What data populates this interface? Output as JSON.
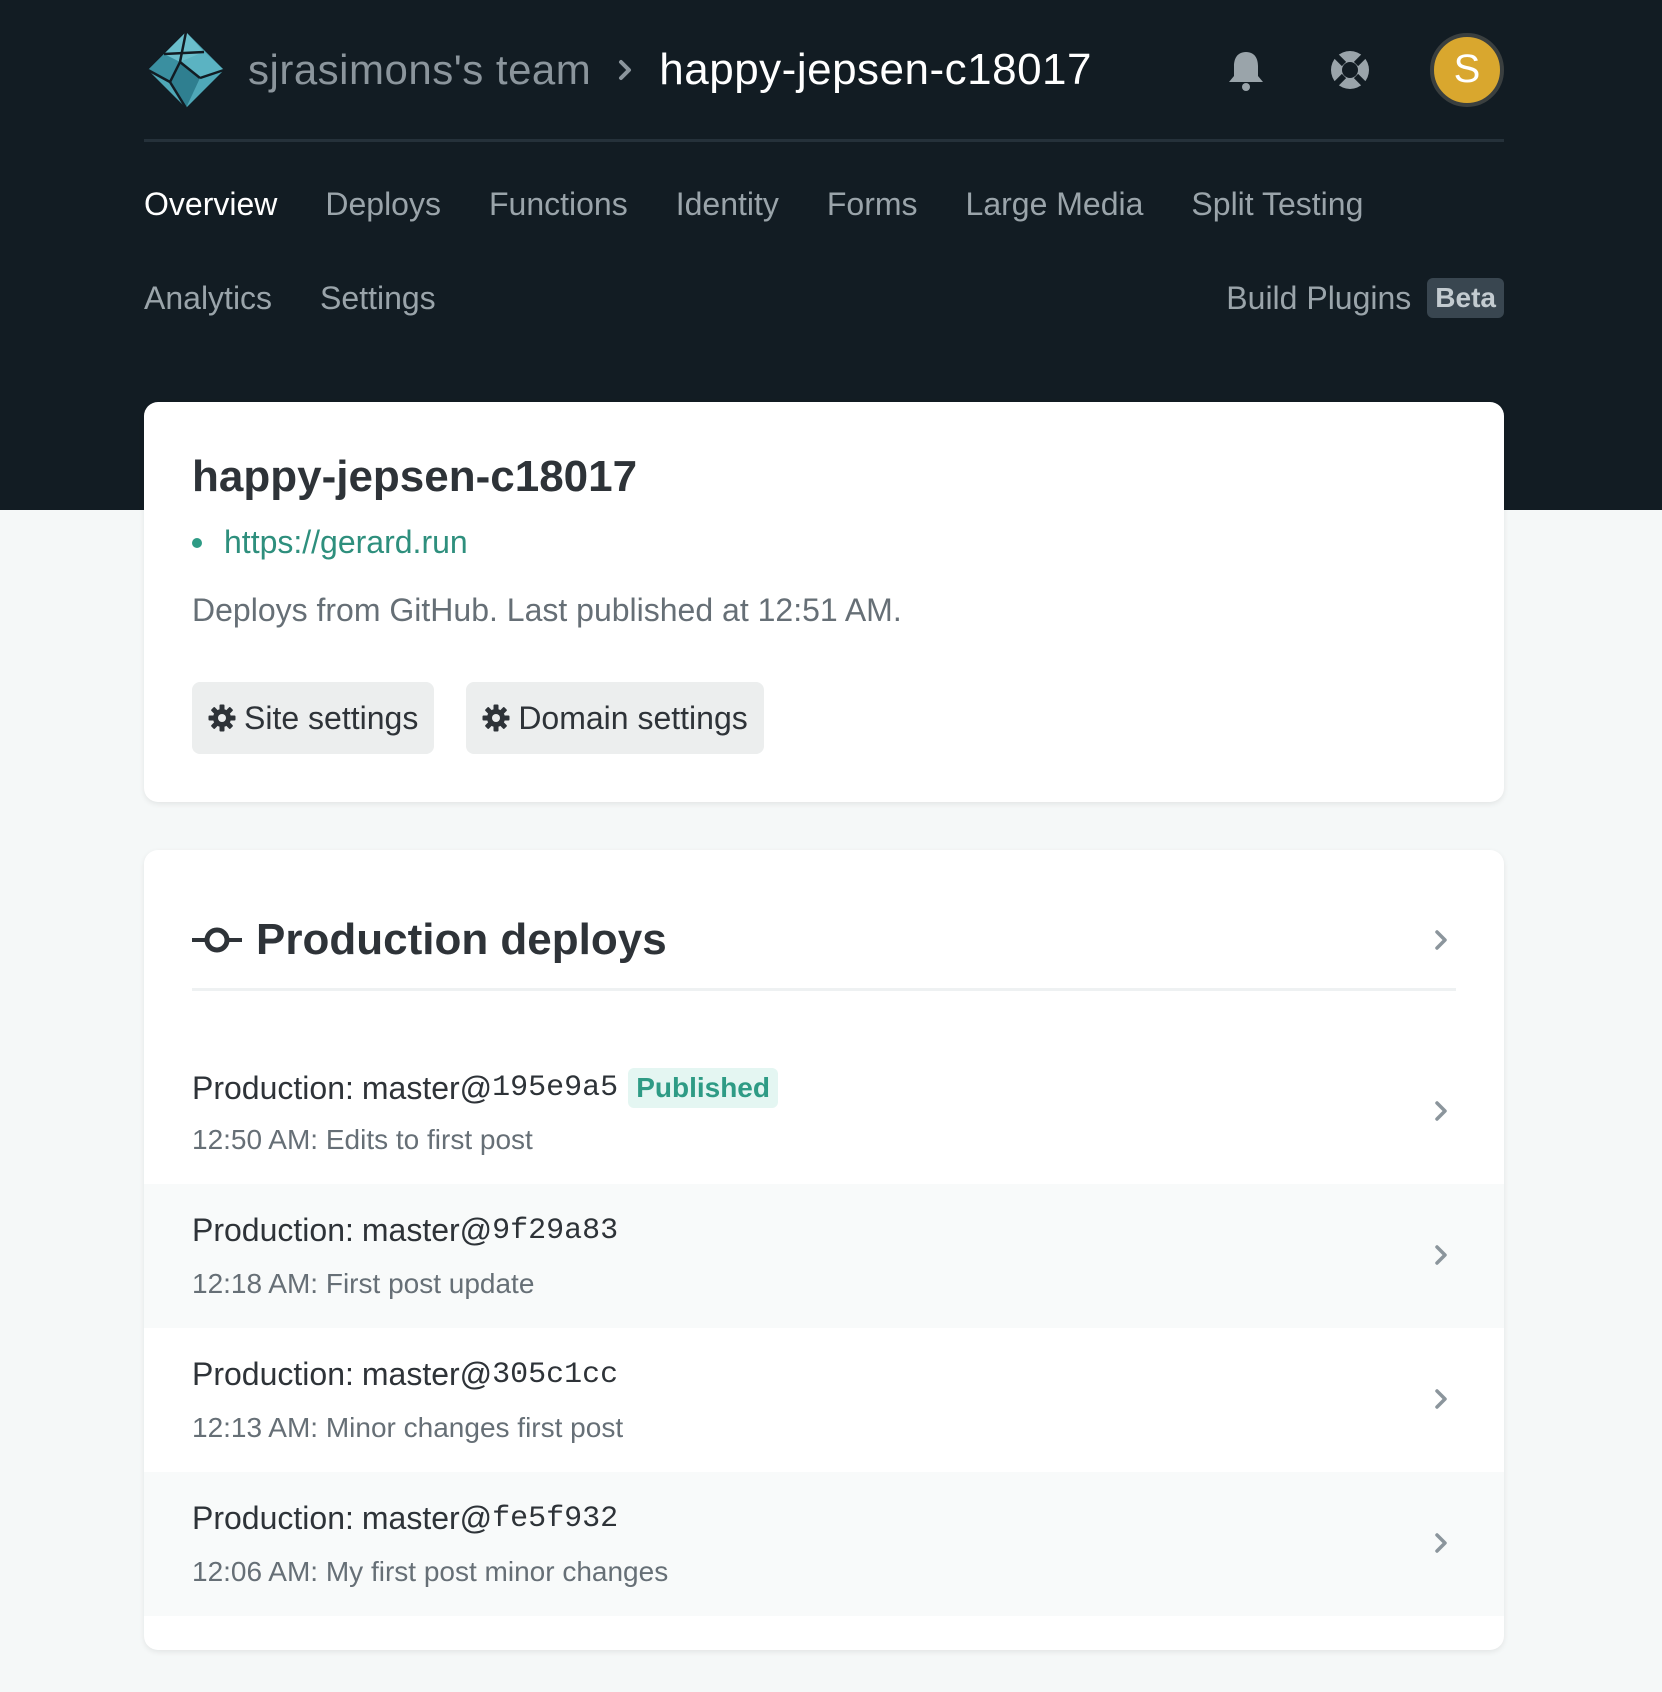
{
  "header": {
    "team": "sjrasimons's team",
    "site": "happy-jepsen-c18017",
    "avatar_initial": "S",
    "avatar_color": "#d9a72e",
    "icons": [
      "netlify-logo-icon",
      "bell-icon",
      "lifebuoy-icon"
    ]
  },
  "nav": {
    "row1": [
      "Overview",
      "Deploys",
      "Functions",
      "Identity",
      "Forms",
      "Large Media",
      "Split Testing"
    ],
    "row2": [
      "Analytics",
      "Settings"
    ],
    "build_plugins": "Build Plugins",
    "beta": "Beta",
    "active": "Overview"
  },
  "site_card": {
    "title": "happy-jepsen-c18017",
    "url": "https://gerard.run",
    "status": "Deploys from GitHub. Last published at 12:51 AM.",
    "site_settings": "Site settings",
    "domain_settings": "Domain settings"
  },
  "production": {
    "title": "Production deploys",
    "deploys": [
      {
        "context": "Production:",
        "branch": "master@",
        "sha": "195e9a5",
        "badge": "Published",
        "message": "12:50 AM: Edits to first post"
      },
      {
        "context": "Production:",
        "branch": "master@",
        "sha": "9f29a83",
        "badge": "",
        "message": "12:18 AM: First post update"
      },
      {
        "context": "Production:",
        "branch": "master@",
        "sha": "305c1cc",
        "badge": "",
        "message": "12:13 AM: Minor changes first post"
      },
      {
        "context": "Production:",
        "branch": "master@",
        "sha": "fe5f932",
        "badge": "",
        "message": "12:06 AM: My first post minor changes"
      }
    ]
  },
  "colors": {
    "header_bg": "#121c23",
    "accent": "#2e9b85",
    "page_bg": "#f5f8f8"
  }
}
